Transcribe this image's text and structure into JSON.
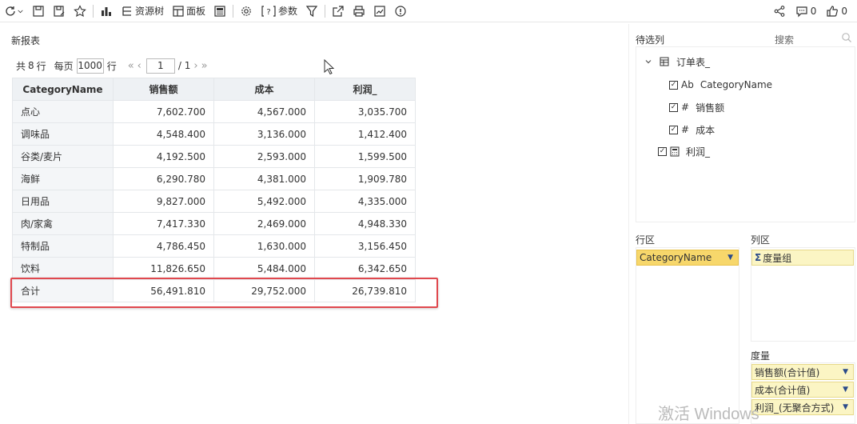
{
  "toolbar": {
    "resource_tree": "资源树",
    "panel": "面板",
    "params": "参数",
    "comment_count": "0",
    "like_count": "0"
  },
  "report": {
    "title": "新报表",
    "pager": {
      "total_prefix": "共",
      "total": "8",
      "total_suffix": "行",
      "per_page_label": "每页",
      "per_page": "1000",
      "per_page_suffix": "行",
      "page": "1",
      "page_total": "/ 1"
    },
    "columns": [
      "CategoryName",
      "销售额",
      "成本",
      "利润_"
    ],
    "rows": [
      [
        "点心",
        "7,602.700",
        "4,567.000",
        "3,035.700"
      ],
      [
        "调味品",
        "4,548.400",
        "3,136.000",
        "1,412.400"
      ],
      [
        "谷类/麦片",
        "4,192.500",
        "2,593.000",
        "1,599.500"
      ],
      [
        "海鲜",
        "6,290.780",
        "4,381.000",
        "1,909.780"
      ],
      [
        "日用品",
        "9,827.000",
        "5,492.000",
        "4,335.000"
      ],
      [
        "肉/家禽",
        "7,417.330",
        "2,469.000",
        "4,948.330"
      ],
      [
        "特制品",
        "4,786.450",
        "1,630.000",
        "3,156.450"
      ],
      [
        "饮料",
        "11,826.650",
        "5,484.000",
        "6,342.650"
      ]
    ],
    "total_row": [
      "合计",
      "56,491.810",
      "29,752.000",
      "26,739.810"
    ]
  },
  "panel": {
    "pending_title": "待选列",
    "search_label": "搜索",
    "table_name": "订单表_",
    "fields": [
      {
        "label": "CategoryName",
        "icon": "Ab"
      },
      {
        "label": "销售额",
        "icon": "#"
      },
      {
        "label": "成本",
        "icon": "#"
      }
    ],
    "calc_field": "利润_",
    "row_zone_label": "行区",
    "col_zone_label": "列区",
    "row_chip": "CategoryName",
    "col_chip": "度量组",
    "measure_label": "度量",
    "measures": [
      "销售额(合计值)",
      "成本(合计值)",
      "利润_(无聚合方式)"
    ]
  },
  "watermark": "激活 Windows",
  "colors": {
    "highlight": "#e0484e",
    "dim_chip": "#f7d76b",
    "measure_chip": "#fbf5c4",
    "header_bg": "#eef1f4"
  }
}
